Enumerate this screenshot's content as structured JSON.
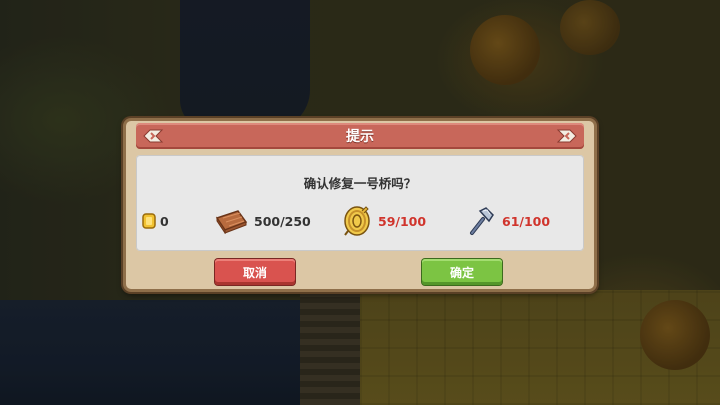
{
  "dialog": {
    "title": "提示",
    "question": "确认修复一号桥吗？",
    "cancel_label": "取消",
    "confirm_label": "确定"
  },
  "resources": [
    {
      "icon": "gold-coin-icon",
      "text": "0",
      "color": "#333333"
    },
    {
      "icon": "wood-plank-icon",
      "text": "500/250",
      "color": "#333333"
    },
    {
      "icon": "rope-icon",
      "text": "59/100",
      "color": "#d0342c"
    },
    {
      "icon": "hammer-icon",
      "text": "61/100",
      "color": "#d0342c"
    }
  ],
  "colors": {
    "header": "#c8675a",
    "cancel": "#d9534f",
    "confirm": "#7cc443",
    "insufficient": "#d0342c"
  }
}
